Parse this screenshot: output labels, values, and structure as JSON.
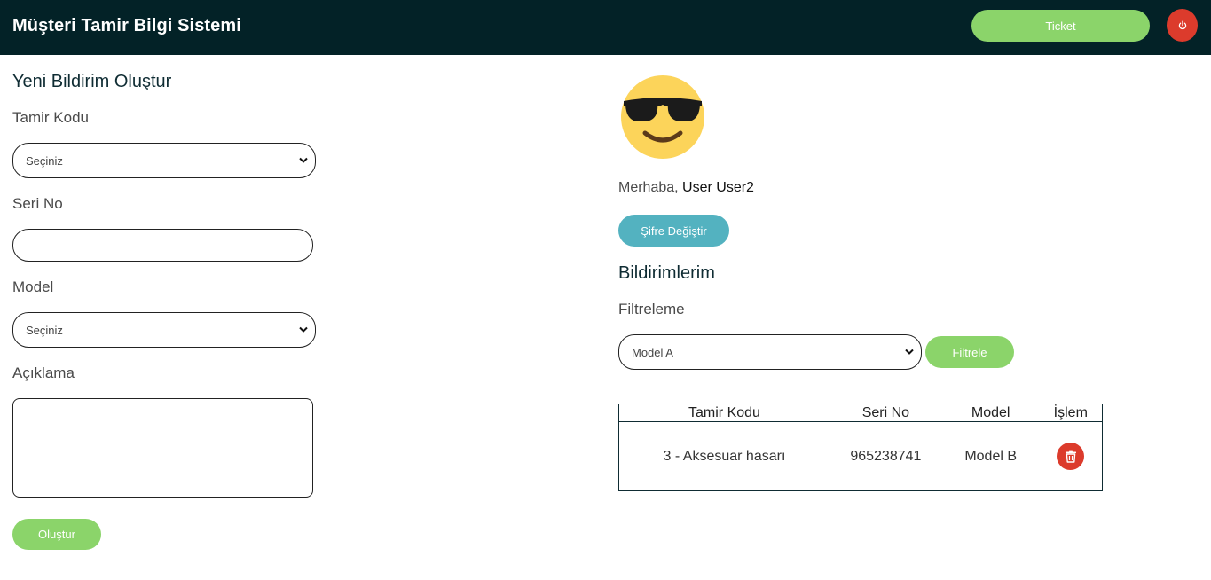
{
  "header": {
    "brand": "Müşteri Tamir Bilgi Sistemi",
    "ticket_label": "Ticket",
    "logout_icon": "power-icon"
  },
  "new_report": {
    "title": "Yeni Bildirim Oluştur",
    "repair_code": {
      "label": "Tamir Kodu",
      "selected": "Seçiniz"
    },
    "serial_no": {
      "label": "Seri No",
      "value": ""
    },
    "model": {
      "label": "Model",
      "selected": "Seçiniz"
    },
    "description": {
      "label": "Açıklama",
      "value": ""
    },
    "submit_label": "Oluştur"
  },
  "profile": {
    "avatar_icon": "sunglasses-emoji-icon",
    "greeting": "Merhaba,",
    "user_name": "User User2",
    "change_password_label": "Şifre Değiştir"
  },
  "my_reports": {
    "title": "Bildirimlerim",
    "filter": {
      "label": "Filtreleme",
      "selected": "Model A",
      "button_label": "Filtrele"
    },
    "columns": [
      "Tamir Kodu",
      "Seri No",
      "Model",
      "İşlem"
    ],
    "rows": [
      {
        "repair_code": "3 - Aksesuar hasarı",
        "serial_no": "965238741",
        "model": "Model B",
        "action_icon": "trash-icon"
      }
    ]
  },
  "colors": {
    "navbar": "#032227",
    "green": "#8bd46a",
    "teal": "#53b2c0",
    "red": "#dc3b2c"
  }
}
